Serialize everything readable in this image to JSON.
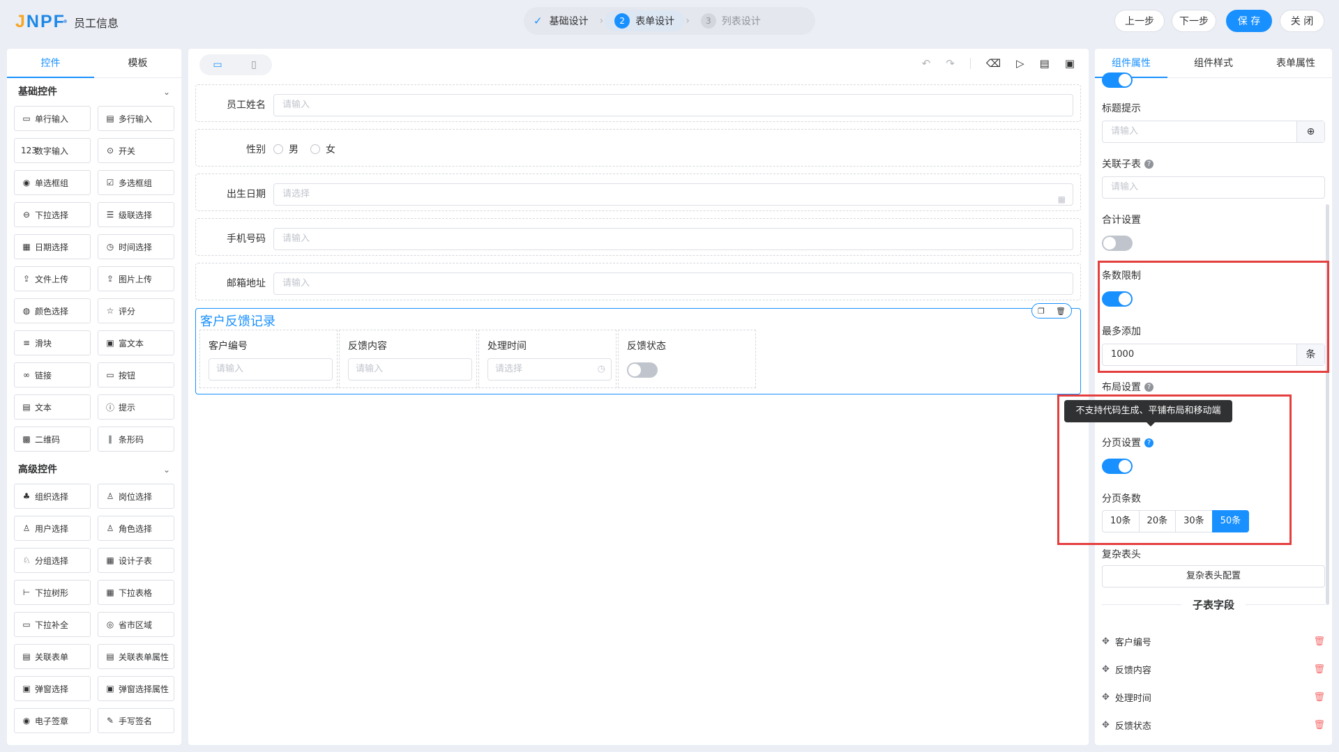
{
  "header": {
    "logo": "JNPF",
    "title": "员工信息",
    "steps": [
      {
        "label": "基础设计",
        "state": "done"
      },
      {
        "num": "2",
        "label": "表单设计",
        "state": "active"
      },
      {
        "num": "3",
        "label": "列表设计",
        "state": "todo"
      }
    ],
    "buttons": {
      "prev": "上一步",
      "next": "下一步",
      "save": "保 存",
      "close": "关 闭"
    }
  },
  "left": {
    "tabs": [
      "控件",
      "模板"
    ],
    "basic_title": "基础控件",
    "basic": [
      {
        "icon": "▭",
        "label": "单行输入"
      },
      {
        "icon": "▤",
        "label": "多行输入"
      },
      {
        "icon": "123",
        "label": "数字输入"
      },
      {
        "icon": "⊙",
        "label": "开关"
      },
      {
        "icon": "◉",
        "label": "单选框组"
      },
      {
        "icon": "☑",
        "label": "多选框组"
      },
      {
        "icon": "⊖",
        "label": "下拉选择"
      },
      {
        "icon": "☰",
        "label": "级联选择"
      },
      {
        "icon": "▦",
        "label": "日期选择"
      },
      {
        "icon": "◷",
        "label": "时间选择"
      },
      {
        "icon": "⇪",
        "label": "文件上传"
      },
      {
        "icon": "⇪",
        "label": "图片上传"
      },
      {
        "icon": "◍",
        "label": "颜色选择"
      },
      {
        "icon": "☆",
        "label": "评分"
      },
      {
        "icon": "≡",
        "label": "滑块"
      },
      {
        "icon": "▣",
        "label": "富文本"
      },
      {
        "icon": "∞",
        "label": "链接"
      },
      {
        "icon": "▭",
        "label": "按钮"
      },
      {
        "icon": "▤",
        "label": "文本"
      },
      {
        "icon": "ⓘ",
        "label": "提示"
      },
      {
        "icon": "▩",
        "label": "二维码"
      },
      {
        "icon": "∥",
        "label": "条形码"
      }
    ],
    "advanced_title": "高级控件",
    "advanced": [
      {
        "icon": "♣",
        "label": "组织选择"
      },
      {
        "icon": "♙",
        "label": "岗位选择"
      },
      {
        "icon": "♙",
        "label": "用户选择"
      },
      {
        "icon": "♙",
        "label": "角色选择"
      },
      {
        "icon": "♘",
        "label": "分组选择"
      },
      {
        "icon": "▦",
        "label": "设计子表"
      },
      {
        "icon": "⊢",
        "label": "下拉树形"
      },
      {
        "icon": "▦",
        "label": "下拉表格"
      },
      {
        "icon": "▭",
        "label": "下拉补全"
      },
      {
        "icon": "◎",
        "label": "省市区域"
      },
      {
        "icon": "▤",
        "label": "关联表单"
      },
      {
        "icon": "▤",
        "label": "关联表单属性"
      },
      {
        "icon": "▣",
        "label": "弹窗选择"
      },
      {
        "icon": "▣",
        "label": "弹窗选择属性"
      },
      {
        "icon": "◉",
        "label": "电子签章"
      },
      {
        "icon": "✎",
        "label": "手写签名"
      }
    ]
  },
  "center": {
    "fields": [
      {
        "label": "员工姓名",
        "placeholder": "请输入"
      },
      {
        "label": "性别",
        "options": [
          "男",
          "女"
        ]
      },
      {
        "label": "出生日期",
        "placeholder": "请选择"
      },
      {
        "label": "手机号码",
        "placeholder": "请输入"
      },
      {
        "label": "邮箱地址",
        "placeholder": "请输入"
      }
    ],
    "subtable": {
      "title": "客户反馈记录",
      "columns": [
        {
          "header": "客户编号",
          "placeholder": "请输入"
        },
        {
          "header": "反馈内容",
          "placeholder": "请输入"
        },
        {
          "header": "处理时间",
          "placeholder": "请选择"
        },
        {
          "header": "反馈状态"
        }
      ]
    }
  },
  "right": {
    "tabs": [
      "组件属性",
      "组件样式",
      "表单属性"
    ],
    "title_hint_label": "标题提示",
    "title_hint_placeholder": "请输入",
    "related_label": "关联子表",
    "related_placeholder": "请输入",
    "sum_label": "合计设置",
    "limit_label": "条数限制",
    "max_label": "最多添加",
    "max_value": "1000",
    "max_unit": "条",
    "layout_label": "布局设置",
    "tooltip": "不支持代码生成、平铺布局和移动端",
    "paging_label": "分页设置",
    "page_size_label": "分页条数",
    "page_sizes": [
      "10条",
      "20条",
      "30条",
      "50条"
    ],
    "complex_label": "复杂表头",
    "complex_button": "复杂表头配置",
    "sub_fields_title": "子表字段",
    "sub_fields": [
      "客户编号",
      "反馈内容",
      "处理时间",
      "反馈状态"
    ]
  }
}
